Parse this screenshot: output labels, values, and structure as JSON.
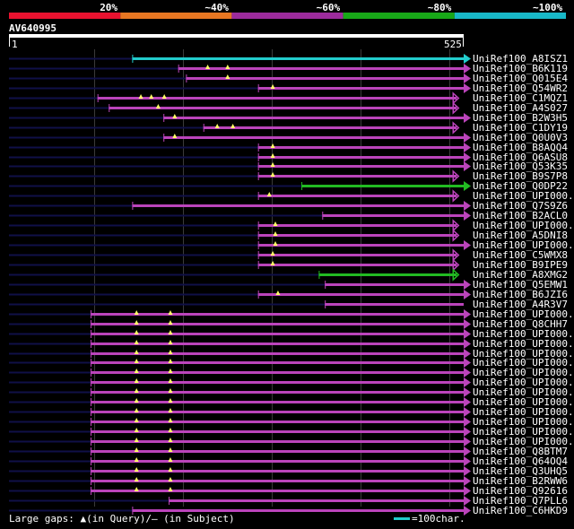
{
  "query": {
    "name": "AV640995",
    "start": "1",
    "end": "525",
    "length": 525
  },
  "identity_scale": [
    {
      "label": "20%",
      "color": "#e8122f"
    },
    {
      "label": "~40%",
      "color": "#e87722"
    },
    {
      "label": "~60%",
      "color": "#9c2b9c"
    },
    {
      "label": "~80%",
      "color": "#18a818"
    },
    {
      "label": "~100%",
      "color": "#18b8c8"
    }
  ],
  "colors": {
    "purple": "#bb44bb",
    "green": "#22bb22",
    "cyan": "#22cccc",
    "dark": "#101048"
  },
  "hits": [
    {
      "name": "UniRef100_A8ISZ1",
      "color": "cyan",
      "dark_start": 1,
      "start": 143,
      "end": 525,
      "arrow": "right",
      "gaps": []
    },
    {
      "name": "UniRef100_B6K119",
      "color": "purple",
      "dark_start": 1,
      "start": 196,
      "end": 525,
      "arrow": "right",
      "gaps": [
        230,
        253
      ]
    },
    {
      "name": "UniRef100_Q015E4",
      "color": "purple",
      "dark_start": 1,
      "start": 205,
      "end": 525,
      "arrow": "right",
      "gaps": [
        253
      ]
    },
    {
      "name": "UniRef100_Q54WR2",
      "color": "purple",
      "dark_start": 1,
      "start": 288,
      "end": 525,
      "arrow": "right",
      "gaps": [
        305
      ]
    },
    {
      "name": "UniRef100_C1MQZ1",
      "color": "purple",
      "dark_start": 1,
      "start": 103,
      "end": 517,
      "arrow": "closed",
      "gaps": [
        153,
        165,
        180
      ]
    },
    {
      "name": "UniRef100_A4S027",
      "color": "purple",
      "dark_start": 1,
      "start": 116,
      "end": 517,
      "arrow": "closed",
      "gaps": [
        173
      ]
    },
    {
      "name": "UniRef100_B2W3H5",
      "color": "purple",
      "dark_start": 1,
      "start": 179,
      "end": 525,
      "arrow": "right",
      "gaps": [
        192
      ]
    },
    {
      "name": "UniRef100_C1DY19",
      "color": "purple",
      "dark_start": 1,
      "start": 225,
      "end": 517,
      "arrow": "closed",
      "gaps": [
        241,
        259
      ]
    },
    {
      "name": "UniRef100_Q0U0V3",
      "color": "purple",
      "dark_start": 1,
      "start": 179,
      "end": 525,
      "arrow": "right",
      "gaps": [
        192
      ]
    },
    {
      "name": "UniRef100_B8AQQ4",
      "color": "purple",
      "dark_start": 1,
      "start": 288,
      "end": 525,
      "arrow": "right",
      "gaps": [
        305
      ]
    },
    {
      "name": "UniRef100_Q6ASU8",
      "color": "purple",
      "dark_start": 1,
      "start": 288,
      "end": 525,
      "arrow": "right",
      "gaps": [
        305
      ]
    },
    {
      "name": "UniRef100_Q53K35",
      "color": "purple",
      "dark_start": 1,
      "start": 288,
      "end": 525,
      "arrow": "right",
      "gaps": [
        305
      ]
    },
    {
      "name": "UniRef100_B9S7P8",
      "color": "purple",
      "dark_start": 1,
      "start": 288,
      "end": 517,
      "arrow": "closed",
      "gaps": [
        305
      ]
    },
    {
      "name": "UniRef100_Q0DP22",
      "color": "green",
      "dark_start": 1,
      "start": 338,
      "end": 525,
      "arrow": "right",
      "gaps": []
    },
    {
      "name": "UniRef100_UPI000..",
      "color": "purple",
      "dark_start": 1,
      "start": 288,
      "end": 517,
      "arrow": "closed",
      "gaps": [
        301
      ]
    },
    {
      "name": "UniRef100_Q7S9Z6",
      "color": "purple",
      "dark_start": 1,
      "start": 143,
      "end": 525,
      "arrow": "right",
      "gaps": []
    },
    {
      "name": "UniRef100_B2ACL0",
      "color": "purple",
      "dark_start": 1,
      "start": 362,
      "end": 525,
      "arrow": "right",
      "gaps": []
    },
    {
      "name": "UniRef100_UPI000..",
      "color": "purple",
      "dark_start": 1,
      "start": 288,
      "end": 517,
      "arrow": "closed",
      "gaps": [
        308
      ]
    },
    {
      "name": "UniRef100_A5DNI8",
      "color": "purple",
      "dark_start": 1,
      "start": 288,
      "end": 517,
      "arrow": "closed",
      "gaps": [
        308
      ]
    },
    {
      "name": "UniRef100_UPI000..",
      "color": "purple",
      "dark_start": 1,
      "start": 288,
      "end": 525,
      "arrow": "right",
      "gaps": [
        308
      ]
    },
    {
      "name": "UniRef100_C5WMX8",
      "color": "purple",
      "dark_start": 1,
      "start": 288,
      "end": 517,
      "arrow": "closed",
      "gaps": [
        305
      ]
    },
    {
      "name": "UniRef100_B9IPE9",
      "color": "purple",
      "dark_start": 1,
      "start": 288,
      "end": 517,
      "arrow": "closed",
      "gaps": [
        305
      ]
    },
    {
      "name": "UniRef100_A8XMG2",
      "color": "green",
      "dark_start": 1,
      "start": 358,
      "end": 517,
      "arrow": "closed",
      "gaps": []
    },
    {
      "name": "UniRef100_Q5EMW1",
      "color": "purple",
      "dark_start": 1,
      "start": 365,
      "end": 525,
      "arrow": "right",
      "gaps": []
    },
    {
      "name": "UniRef100_B6JZI6",
      "color": "purple",
      "dark_start": 1,
      "start": 288,
      "end": 525,
      "arrow": "right",
      "gaps": [
        311
      ]
    },
    {
      "name": "UniRef100_A4R3V7",
      "color": "purple",
      "dark_start": 1,
      "start": 365,
      "end": 525,
      "arrow": "none",
      "gaps": []
    },
    {
      "name": "UniRef100_UPI000..",
      "color": "purple",
      "dark_start": 1,
      "start": 95,
      "end": 525,
      "arrow": "right",
      "gaps": [
        148,
        187
      ]
    },
    {
      "name": "UniRef100_Q8CHH7",
      "color": "purple",
      "dark_start": 1,
      "start": 95,
      "end": 525,
      "arrow": "right",
      "gaps": [
        148,
        187
      ]
    },
    {
      "name": "UniRef100_UPI000..",
      "color": "purple",
      "dark_start": 1,
      "start": 95,
      "end": 525,
      "arrow": "right",
      "gaps": [
        148,
        187
      ]
    },
    {
      "name": "UniRef100_UPI000..",
      "color": "purple",
      "dark_start": 1,
      "start": 95,
      "end": 525,
      "arrow": "right",
      "gaps": [
        148,
        187
      ]
    },
    {
      "name": "UniRef100_UPI000..",
      "color": "purple",
      "dark_start": 1,
      "start": 95,
      "end": 525,
      "arrow": "right",
      "gaps": [
        148,
        187
      ]
    },
    {
      "name": "UniRef100_UPI000..",
      "color": "purple",
      "dark_start": 1,
      "start": 95,
      "end": 525,
      "arrow": "right",
      "gaps": [
        148,
        187
      ]
    },
    {
      "name": "UniRef100_UPI000..",
      "color": "purple",
      "dark_start": 1,
      "start": 95,
      "end": 525,
      "arrow": "right",
      "gaps": [
        148,
        187
      ]
    },
    {
      "name": "UniRef100_UPI000..",
      "color": "purple",
      "dark_start": 1,
      "start": 95,
      "end": 525,
      "arrow": "right",
      "gaps": [
        148,
        187
      ]
    },
    {
      "name": "UniRef100_UPI000..",
      "color": "purple",
      "dark_start": 1,
      "start": 95,
      "end": 525,
      "arrow": "right",
      "gaps": [
        148,
        187
      ]
    },
    {
      "name": "UniRef100_UPI000..",
      "color": "purple",
      "dark_start": 1,
      "start": 95,
      "end": 525,
      "arrow": "right",
      "gaps": [
        148,
        187
      ]
    },
    {
      "name": "UniRef100_UPI000..",
      "color": "purple",
      "dark_start": 1,
      "start": 95,
      "end": 525,
      "arrow": "right",
      "gaps": [
        148,
        187
      ]
    },
    {
      "name": "UniRef100_UPI000..",
      "color": "purple",
      "dark_start": 1,
      "start": 95,
      "end": 525,
      "arrow": "right",
      "gaps": [
        148,
        187
      ]
    },
    {
      "name": "UniRef100_UPI000..",
      "color": "purple",
      "dark_start": 1,
      "start": 95,
      "end": 525,
      "arrow": "right",
      "gaps": [
        148,
        187
      ]
    },
    {
      "name": "UniRef100_UPI000..",
      "color": "purple",
      "dark_start": 1,
      "start": 95,
      "end": 525,
      "arrow": "right",
      "gaps": [
        148,
        187
      ]
    },
    {
      "name": "UniRef100_Q8BTM7",
      "color": "purple",
      "dark_start": 1,
      "start": 95,
      "end": 525,
      "arrow": "right",
      "gaps": [
        148,
        187
      ]
    },
    {
      "name": "UniRef100_Q64OQ4",
      "color": "purple",
      "dark_start": 1,
      "start": 95,
      "end": 525,
      "arrow": "right",
      "gaps": [
        148,
        187
      ]
    },
    {
      "name": "UniRef100_Q3UHQ5",
      "color": "purple",
      "dark_start": 1,
      "start": 95,
      "end": 525,
      "arrow": "right",
      "gaps": [
        148,
        187
      ]
    },
    {
      "name": "UniRef100_B2RWW6",
      "color": "purple",
      "dark_start": 1,
      "start": 95,
      "end": 525,
      "arrow": "right",
      "gaps": [
        148,
        187
      ]
    },
    {
      "name": "UniRef100_Q92616",
      "color": "purple",
      "dark_start": 1,
      "start": 95,
      "end": 525,
      "arrow": "right",
      "gaps": [
        148,
        187
      ]
    },
    {
      "name": "UniRef100_Q7PLL6",
      "color": "purple",
      "dark_start": 1,
      "start": 185,
      "end": 525,
      "arrow": "right",
      "gaps": []
    },
    {
      "name": "UniRef100_C6HKD9",
      "color": "purple",
      "dark_start": 1,
      "start": 143,
      "end": 525,
      "arrow": "right",
      "gaps": []
    }
  ],
  "footer": {
    "legend_text": "Large gaps: ▲(in Query)/— (in Subject)",
    "scale_text": "=100char."
  }
}
